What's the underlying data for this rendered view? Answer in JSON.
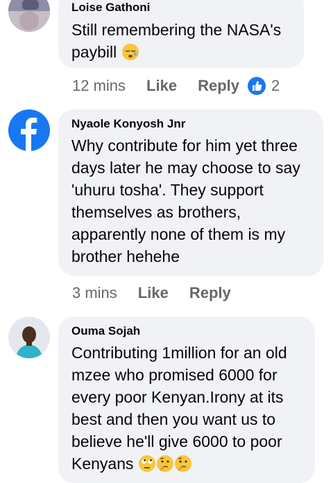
{
  "comments": [
    {
      "author": "Loise Gathoni",
      "text_lines": [
        "Still remembering the NASA's",
        "paybill"
      ],
      "time": "12 mins",
      "like_label": "Like",
      "reply_label": "Reply",
      "reaction_count": "2",
      "reaction_icon": "thumbs-up-icon",
      "emoji": [
        "sleepy-face-icon"
      ]
    },
    {
      "author": "Nyaole Konyosh Jnr",
      "text_lines": [
        "Why contribute for him yet three",
        "days later he may choose to say",
        "'uhuru tosha'. They support",
        "themselves as brothers,",
        "apparently none of them is my",
        "brother hehehe"
      ],
      "time": "3 mins",
      "like_label": "Like",
      "reply_label": "Reply",
      "avatar_icon": "facebook-logo-icon"
    },
    {
      "author": "Ouma Sojah",
      "text_lines": [
        "Contributing 1million for an old",
        "mzee who promised 6000 for",
        "every poor Kenyan.Irony at its",
        "best and then you want us to",
        "believe he'll give 6000 to poor",
        "Kenyans"
      ],
      "emoji": [
        "eye-roll-face-icon",
        "thinking-face-icon",
        "thinking-face-icon"
      ]
    }
  ],
  "colors": {
    "bubble": "#f0f2f5",
    "meta_text": "#65676b",
    "facebook_blue": "#1877f2"
  }
}
